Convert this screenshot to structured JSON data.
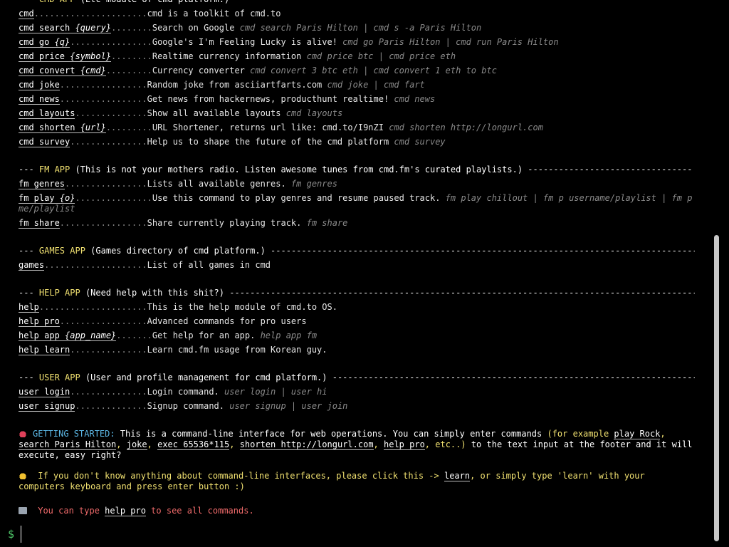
{
  "sections": [
    {
      "app": "CMD APP",
      "desc": "(Etc module of cmd platform.)",
      "dashes": "------------------------------------------------------------------------------------------------",
      "commands": [
        {
          "cmd": "cmd",
          "arg": "",
          "dots": "......................",
          "info": "cmd is a toolkit of cmd.to",
          "ex": ""
        },
        {
          "cmd": "cmd search ",
          "arg": "{query}",
          "dots": "........",
          "info": "Search on Google ",
          "ex": "cmd search Paris Hilton | cmd s -a Paris Hilton"
        },
        {
          "cmd": "cmd go ",
          "arg": "{q}",
          "dots": "................",
          "info": "Google's I'm Feeling Lucky is alive! ",
          "ex": "cmd go Paris Hilton | cmd run Paris Hilton"
        },
        {
          "cmd": "cmd price ",
          "arg": "{symbol}",
          "dots": "........",
          "info": "Realtime currency information ",
          "ex": "cmd price btc | cmd price eth"
        },
        {
          "cmd": "cmd convert ",
          "arg": "{cmd}",
          "dots": ".........",
          "info": "Currency converter ",
          "ex": "cmd convert 3 btc eth | cmd convert 1 eth to btc"
        },
        {
          "cmd": "cmd joke",
          "arg": "",
          "dots": ".................",
          "info": "Random joke from asciiartfarts.com ",
          "ex": "cmd joke | cmd fart"
        },
        {
          "cmd": "cmd news",
          "arg": "",
          "dots": ".................",
          "info": "Get news from hackernews, producthunt realtime! ",
          "ex": "cmd news"
        },
        {
          "cmd": "cmd layouts",
          "arg": "",
          "dots": "..............",
          "info": "Show all available layouts ",
          "ex": "cmd layouts"
        },
        {
          "cmd": "cmd shorten ",
          "arg": "{url}",
          "dots": ".........",
          "info": "URL Shortener, returns url like: cmd.to/I9nZI ",
          "ex": "cmd shorten http://longurl.com"
        },
        {
          "cmd": "cmd survey",
          "arg": "",
          "dots": "...............",
          "info": "Help us to shape the future of the cmd platform ",
          "ex": "cmd survey"
        }
      ]
    },
    {
      "app": "FM APP",
      "desc": "(This is not your mothers radio. Listen awesome tunes from cmd.fm's curated playlists.)",
      "dashes": "--------------------------------",
      "commands": [
        {
          "cmd": "fm genres",
          "arg": "",
          "dots": "................",
          "info": "Lists all available genres. ",
          "ex": "fm genres"
        },
        {
          "cmd": "fm play ",
          "arg": "{o}",
          "dots": "...............",
          "info": "Use this command to play genres and resume paused track. ",
          "ex": "fm play chillout | fm p username/playlist | fm p me/playlist",
          "wrap": true
        },
        {
          "cmd": "fm share",
          "arg": "",
          "dots": ".................",
          "info": "Share currently playing track. ",
          "ex": "fm share"
        }
      ]
    },
    {
      "app": "GAMES APP",
      "desc": "(Games directory of cmd platform.)",
      "dashes": "-----------------------------------------------------------------------------------------------",
      "commands": [
        {
          "cmd": "games",
          "arg": "",
          "dots": "....................",
          "info": "List of all games in cmd",
          "ex": ""
        }
      ]
    },
    {
      "app": "HELP APP",
      "desc": "(Need help with this shit?)",
      "dashes": "-----------------------------------------------------------------------------------------------------------",
      "commands": [
        {
          "cmd": "help",
          "arg": "",
          "dots": ".....................",
          "info": "This is the help module of cmd.to OS.",
          "ex": ""
        },
        {
          "cmd": "help pro",
          "arg": "",
          "dots": ".................",
          "info": "Advanced commands for pro users",
          "ex": ""
        },
        {
          "cmd": "help app ",
          "arg": "{app_name}",
          "dots": ".......",
          "info": "Get help for an app. ",
          "ex": "help app fm"
        },
        {
          "cmd": "help learn",
          "arg": "",
          "dots": "...............",
          "info": "Learn cmd.fm usage from Korean guy.",
          "ex": ""
        }
      ]
    },
    {
      "app": "USER APP",
      "desc": "(User and profile management for cmd platform.)",
      "dashes": "-------------------------------------------------------------------------------------",
      "commands": [
        {
          "cmd": "user login",
          "arg": "",
          "dots": "...............",
          "info": "Login command. ",
          "ex": "user login | user hi"
        },
        {
          "cmd": "user signup",
          "arg": "",
          "dots": "..............",
          "info": "Signup command. ",
          "ex": "user signup | user join"
        }
      ]
    }
  ],
  "getting_started": {
    "title": "GETTING STARTED:",
    "text1": " This is a command-line interface for web operations. You can simply enter commands ",
    "example_open": "(for example ",
    "examples": [
      "play Rock",
      "search Paris Hilton",
      "joke",
      "exec 65536*115",
      "shorten http://longurl.com",
      "help pro"
    ],
    "etc": "etc..)",
    "text2": " to the text input at the footer and it will execute, easy right?"
  },
  "hint": {
    "text1": " If you don't know anything about command-line interfaces, please click this -> ",
    "link": "learn",
    "text2": ", or simply type 'learn' with your computers keyboard and press enter button :)"
  },
  "tip": {
    "text1": " You can type ",
    "cmd": "help pro",
    "text2": " to see all commands."
  },
  "prompt": {
    "symbol": "$",
    "value": ""
  },
  "colors": {
    "background": "#000000",
    "app_name": "#f0e070",
    "example": "#8a8a8a",
    "prompt": "#4fc86a",
    "title": "#5cb8e6",
    "tip": "#ef6a6a"
  },
  "icons": [
    "strawberry-icon",
    "bell-icon",
    "floppy-disk-icon"
  ]
}
